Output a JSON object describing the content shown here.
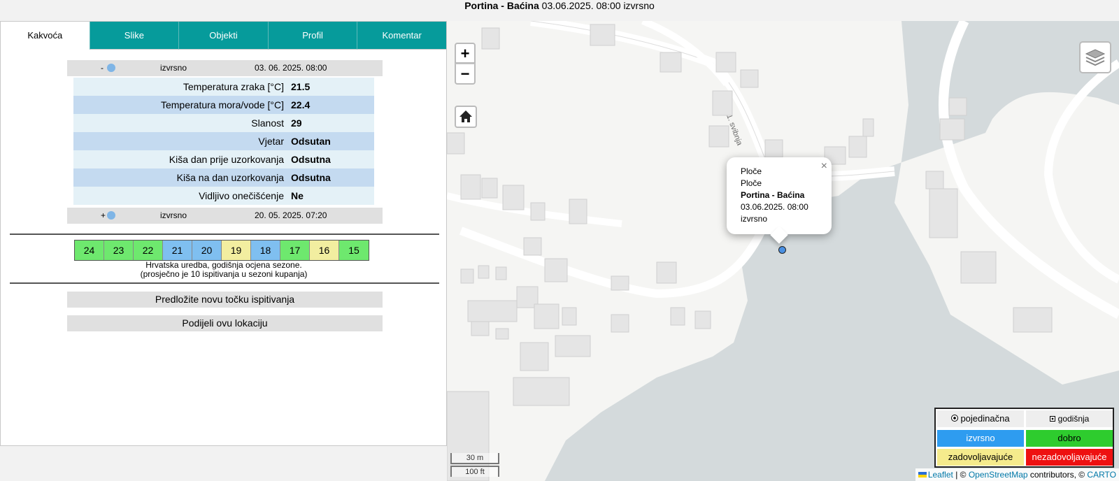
{
  "header": {
    "location": "Portina - Baćina",
    "rest": " 03.06.2025. 08:00 izvrsno"
  },
  "tabs": [
    "Kakvoća",
    "Slike",
    "Objekti",
    "Profil",
    "Komentar"
  ],
  "sample_current": {
    "toggle": "-",
    "status": "izvrsno",
    "date": "03. 06. 2025. 08:00",
    "dot_color": "#7fb5e6"
  },
  "details": [
    {
      "label": "Temperatura zraka [°C]",
      "value": "21.5"
    },
    {
      "label": "Temperatura mora/vode [°C]",
      "value": "22.4"
    },
    {
      "label": "Slanost",
      "value": "29"
    },
    {
      "label": "Vjetar",
      "value": "Odsutan"
    },
    {
      "label": "Kiša dan prije uzorkovanja",
      "value": "Odsutna"
    },
    {
      "label": "Kiša na dan uzorkovanja",
      "value": "Odsutna"
    },
    {
      "label": "Vidljivo onečišćenje",
      "value": "Ne"
    }
  ],
  "sample_previous": {
    "toggle": "+",
    "status": "izvrsno",
    "date": "20. 05. 2025. 07:20",
    "dot_color": "#7fb5e6"
  },
  "yearly": [
    {
      "year": "24",
      "color": "#6ee86e"
    },
    {
      "year": "23",
      "color": "#6ee86e"
    },
    {
      "year": "22",
      "color": "#6ee86e"
    },
    {
      "year": "21",
      "color": "#7fbff0"
    },
    {
      "year": "20",
      "color": "#7fbff0"
    },
    {
      "year": "19",
      "color": "#f2eea0"
    },
    {
      "year": "18",
      "color": "#7fbff0"
    },
    {
      "year": "17",
      "color": "#6ee86e"
    },
    {
      "year": "16",
      "color": "#f2eea0"
    },
    {
      "year": "15",
      "color": "#6ee86e"
    }
  ],
  "note_line1": "Hrvatska uredba, godišnja ocjena sezone.",
  "note_line2": "(prosječno je 10 ispitivanja u sezoni kupanja)",
  "actions": {
    "propose": "Predložite novu točku ispitivanja",
    "share": "Podijeli ovu lokaciju"
  },
  "map": {
    "zoom_in": "+",
    "zoom_out": "−",
    "popup": {
      "line1": "Ploče",
      "line2": "Ploče",
      "name": "Portina - Baćina",
      "datetime": "03.06.2025. 08:00",
      "status": "izvrsno",
      "close": "×"
    },
    "scale": {
      "metric": "30 m",
      "imperial": "100 ft"
    },
    "road_label": "1. svibnja",
    "legend": {
      "single": "pojedinačna",
      "yearly": "godišnja",
      "excellent": "izvrsno",
      "good": "dobro",
      "sufficient": "zadovoljavajuće",
      "poor": "nezadovoljavajuće",
      "colors": {
        "excellent": "#2e9cf0",
        "good": "#2ecc2e",
        "sufficient": "#f5eb8c",
        "poor": "#ee1111"
      }
    },
    "attribution": {
      "leaflet": "Leaflet",
      "sep1": " | © ",
      "osm": "OpenStreetMap",
      "mid": " contributors, © ",
      "carto": "CARTO"
    }
  }
}
